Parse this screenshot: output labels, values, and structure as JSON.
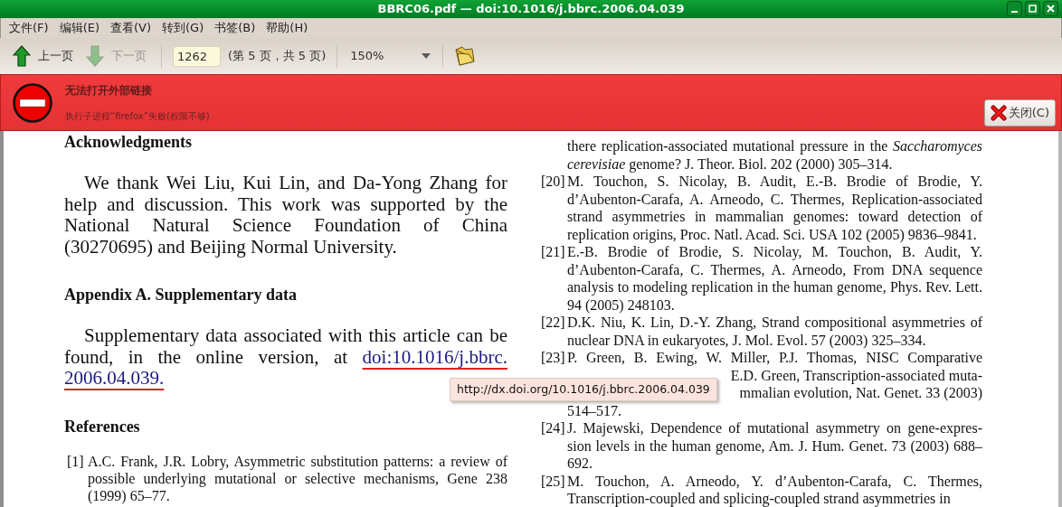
{
  "window": {
    "title": "BBRC06.pdf — doi:10.1016/j.bbrc.2006.04.039"
  },
  "menu": [
    {
      "label": "文件(F)"
    },
    {
      "label": "编辑(E)"
    },
    {
      "label": "查看(V)"
    },
    {
      "label": "转到(G)"
    },
    {
      "label": "书签(B)"
    },
    {
      "label": "帮助(H)"
    }
  ],
  "toolbar": {
    "prev_button": {
      "label": "上一页",
      "disabled": false
    },
    "next_button": {
      "label": "下一页",
      "disabled": true
    },
    "page_field": {
      "value": "1262"
    },
    "page_info": "(第 5 页，共 5 页)",
    "zoom": "150%"
  },
  "error_bar": {
    "title": "无法打开外部链接",
    "message": "执行子进程“firefox”失败(权限不够)",
    "close_button": "关闭(C)"
  },
  "document": {
    "left_column": [
      {
        "kind": "heading",
        "text": "Acknowledgments"
      },
      {
        "kind": "paragraph",
        "text": "We thank Wei Liu, Kui Lin, and Da-Yong Zhang for help and discussion. This work was supported by the National Natural Science Foundation of China (30270695) and Beijing Normal University."
      },
      {
        "kind": "heading",
        "text": "Appendix A. Supplementary data"
      },
      {
        "kind": "paragraph",
        "text": "Supplementary data associated with this article can be found, in the online version, at",
        "link_parts": [
          "doi:10.1016/j.bbrc.",
          "2006.04.039."
        ]
      },
      {
        "kind": "heading",
        "text": "References"
      },
      {
        "kind": "reference",
        "number": "[1]",
        "text": "A.C. Frank, J.R. Lobry, Asymmetric substitution patterns: a review of possible underlying mutational or selective mechanisms, Gene 238 (1999) 65–77."
      }
    ],
    "right_column": [
      {
        "kind": "reference",
        "text": "there replication-associated mutational pressure in the *Saccharomyces cerevisiae* genome? J. Theor. Biol. 202 (2000) 305–314."
      },
      {
        "kind": "reference",
        "number": "[20]",
        "text": "M. Touchon, S. Nicolay, B. Audit, E.-B. Brodie of Brodie, Y. d’Aubenton-Carafa, A. Arneodo, C. Thermes, Replication-associated strand asymmetries in mammalian genomes: toward detection of replication origins, Proc. Natl. Acad. Sci. USA 102 (2005) 9836–9841."
      },
      {
        "kind": "reference",
        "number": "[21]",
        "text": "E.-B. Brodie of Brodie, S. Nicolay, M. Touchon, B. Audit, Y. d’Aubenton-Carafa, C. Thermes, A. Arneodo, From DNA sequence analysis to modeling replication in the human genome, Phys. Rev. Lett. 94 (2005) 248103."
      },
      {
        "kind": "reference",
        "number": "[22]",
        "text": "D.K. Niu, K. Lin, D.-Y. Zhang, Strand compositional asymmetries of nuclear DNA in eukaryotes, J. Mol. Evol. 57 (2003) 325–334."
      },
      {
        "kind": "covered_reference",
        "number": "[23]",
        "text": "P. Green, B. Ewing, W. Miller, P.J. Thomas, NISC Comparative",
        "visible_fragments": [
          "E.D. Green, Transcription-associated muta-",
          "mmalian evolution, Nat. Genet. 33 (2003)"
        ],
        "last_line": "514–517."
      },
      {
        "kind": "reference",
        "number": "[24]",
        "text": "J. Majewski, Dependence of mutational asymmetry on gene-expres-sion levels in the human genome, Am. J. Hum. Genet. 73 (2003) 688–692."
      },
      {
        "kind": "reference",
        "number": "[25]",
        "text": "M. Touchon, A. Arneodo, Y. d’Aubenton-Carafa, C. Thermes, Transcription-coupled and splicing-coupled strand asymmetries in"
      }
    ],
    "tooltip": "http://dx.doi.org/10.1016/j.bbrc.2006.04.039"
  }
}
